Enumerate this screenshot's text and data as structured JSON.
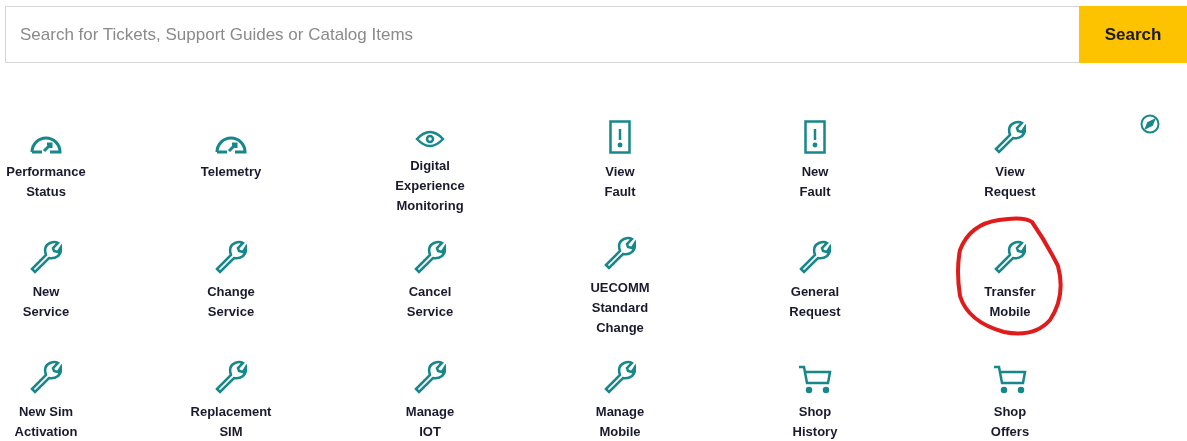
{
  "search": {
    "placeholder": "Search for Tickets, Support Guides or Catalog Items",
    "button": "Search"
  },
  "tiles": [
    {
      "kind": "gauge",
      "label": "Performance\nStatus",
      "circled": false
    },
    {
      "kind": "gauge",
      "label": "Telemetry",
      "circled": false
    },
    {
      "kind": "eye",
      "label": "Digital\nExperience\nMonitoring",
      "circled": false
    },
    {
      "kind": "alert",
      "label": "View\nFault",
      "circled": false
    },
    {
      "kind": "alert",
      "label": "New\nFault",
      "circled": false
    },
    {
      "kind": "wrench",
      "label": "View\nRequest",
      "circled": false
    },
    {
      "kind": "wrench",
      "label": "New\nService",
      "circled": false
    },
    {
      "kind": "wrench",
      "label": "Change\nService",
      "circled": false
    },
    {
      "kind": "wrench",
      "label": "Cancel\nService",
      "circled": false
    },
    {
      "kind": "wrench",
      "label": "UECOMM\nStandard\nChange",
      "circled": false
    },
    {
      "kind": "wrench",
      "label": "General\nRequest",
      "circled": false
    },
    {
      "kind": "wrench",
      "label": "Transfer\nMobile",
      "circled": true
    },
    {
      "kind": "wrench",
      "label": "New Sim\nActivation",
      "circled": false
    },
    {
      "kind": "wrench",
      "label": "Replacement\nSIM",
      "circled": false
    },
    {
      "kind": "wrench",
      "label": "Manage\nIOT",
      "circled": false
    },
    {
      "kind": "wrench",
      "label": "Manage\nMobile",
      "circled": false
    },
    {
      "kind": "cart",
      "label": "Shop\nHistory",
      "circled": false
    },
    {
      "kind": "cart",
      "label": "Shop\nOffers",
      "circled": false
    }
  ]
}
